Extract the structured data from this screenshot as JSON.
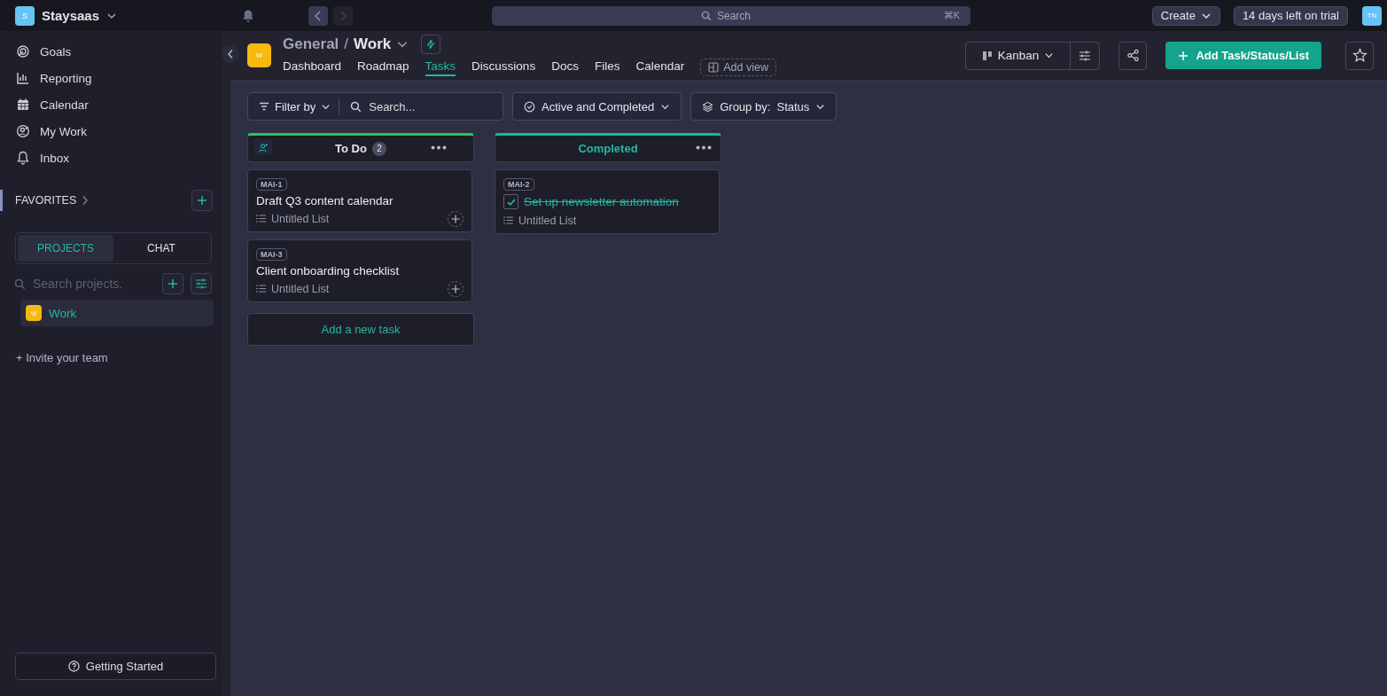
{
  "workspace": {
    "initial": "S",
    "name": "Staysaas"
  },
  "search": {
    "placeholder": "Search",
    "shortcut": "⌘K"
  },
  "top_actions": {
    "create": "Create",
    "trial": "14 days left on trial",
    "avatar": "TN"
  },
  "nav": [
    {
      "label": "Goals"
    },
    {
      "label": "Reporting"
    },
    {
      "label": "Calendar"
    },
    {
      "label": "My Work"
    },
    {
      "label": "Inbox"
    }
  ],
  "favorites": {
    "label": "FAVORITES"
  },
  "sidebar_tabs": [
    {
      "label": "PROJECTS",
      "selected": true
    },
    {
      "label": "CHAT",
      "selected": false
    }
  ],
  "project_search": {
    "placeholder": "Search projects."
  },
  "projects": [
    {
      "initial": "W",
      "name": "Work",
      "selected": true
    }
  ],
  "invite": "+ Invite your team",
  "getting_started": "Getting Started",
  "project": {
    "initial": "W",
    "parent": "General",
    "separator": "/",
    "name": "Work"
  },
  "view_tabs": [
    {
      "label": "Dashboard",
      "selected": false
    },
    {
      "label": "Roadmap",
      "selected": false
    },
    {
      "label": "Tasks",
      "selected": true
    },
    {
      "label": "Discussions",
      "selected": false
    },
    {
      "label": "Docs",
      "selected": false
    },
    {
      "label": "Files",
      "selected": false
    },
    {
      "label": "Calendar",
      "selected": false
    }
  ],
  "add_view": "Add view",
  "view_mode": "Kanban",
  "add_button": "Add Task/Status/List",
  "filters": {
    "filter": "Filter by",
    "search_placeholder": "Search...",
    "status": "Active and Completed",
    "group_label": "Group by:",
    "group_value": "Status"
  },
  "columns": [
    {
      "title": "To Do",
      "count": "2",
      "color": "#22c55e",
      "cards": [
        {
          "id": "MAI-1",
          "title": "Draft Q3 content calendar",
          "list": "Untitled List",
          "done": false
        },
        {
          "id": "MAI-3",
          "title": "Client onboarding checklist",
          "list": "Untitled List",
          "done": false
        }
      ],
      "add_task": "Add a new task"
    },
    {
      "title": "Completed",
      "color": "#14b8a6",
      "cards": [
        {
          "id": "MAI-2",
          "title": "Set up newsletter automation",
          "list": "Untitled List",
          "done": true
        }
      ]
    }
  ]
}
